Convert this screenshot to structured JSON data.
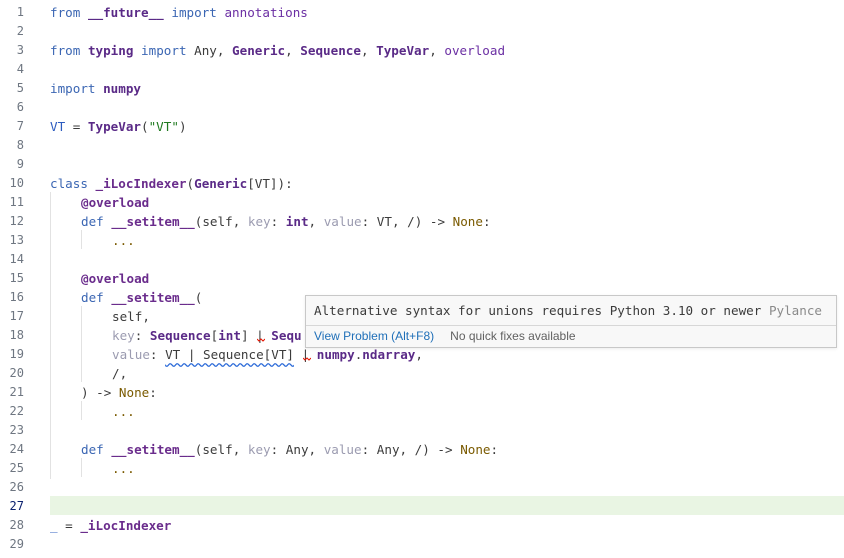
{
  "editor": {
    "line_numbers": [
      "1",
      "2",
      "3",
      "4",
      "5",
      "6",
      "7",
      "8",
      "9",
      "10",
      "11",
      "12",
      "13",
      "14",
      "15",
      "16",
      "17",
      "18",
      "19",
      "20",
      "21",
      "22",
      "23",
      "24",
      "25",
      "26",
      "27",
      "28",
      "29"
    ],
    "active_line": "27",
    "lines": {
      "l1": [
        "from",
        " ",
        "__future__",
        " ",
        "import",
        " ",
        "annotations"
      ],
      "l3": [
        "from",
        " ",
        "typing",
        " ",
        "import",
        " Any, ",
        "Generic",
        ", ",
        "Sequence",
        ", ",
        "TypeVar",
        ", ",
        "overload"
      ],
      "l5": [
        "import",
        " ",
        "numpy"
      ],
      "l7": [
        "VT",
        " = ",
        "TypeVar",
        "(",
        "\"VT\"",
        ")"
      ],
      "l10": [
        "class",
        " ",
        "_iLocIndexer",
        "(",
        "Generic",
        "[VT]):"
      ],
      "l11": [
        "@overload"
      ],
      "l12": [
        "def",
        " ",
        "__setitem__",
        "(",
        "self",
        ", ",
        "key",
        ": ",
        "int",
        ", ",
        "value",
        ": VT, /) -> ",
        "None",
        ":"
      ],
      "l13": [
        "..."
      ],
      "l15": [
        "@overload"
      ],
      "l16": [
        "def",
        " ",
        "__setitem__",
        "("
      ],
      "l17": [
        "self",
        ","
      ],
      "l18": [
        "key",
        ": ",
        "Sequence",
        "[",
        "int",
        "] ",
        "|",
        " ",
        "Sequ"
      ],
      "l19": [
        "value",
        ": ",
        "VT | Sequence[VT]",
        " ",
        "|",
        " ",
        "numpy",
        ".",
        "ndarray",
        ","
      ],
      "l20": [
        "/,"
      ],
      "l21": [
        ") -> ",
        "None",
        ":"
      ],
      "l22": [
        "..."
      ],
      "l24": [
        "def",
        " ",
        "__setitem__",
        "(",
        "self",
        ", ",
        "key",
        ": Any, ",
        "value",
        ": Any, /) -> ",
        "None",
        ":"
      ],
      "l25": [
        "..."
      ],
      "l28": [
        "_",
        " = ",
        "_iLocIndexer"
      ]
    }
  },
  "hover": {
    "message": "Alternative syntax for unions requires Python 3.10 or newer",
    "source": "Pylance",
    "view_problem": "View Problem (Alt+F8)",
    "no_fixes": "No quick fixes available"
  },
  "colors": {
    "keyword": "#3b66b3",
    "type": "#5a2a87",
    "string": "#1f7a1f",
    "current_line": "#e9f5e3",
    "error_squiggle": "#e51400",
    "info_squiggle": "#2b6ad8"
  }
}
